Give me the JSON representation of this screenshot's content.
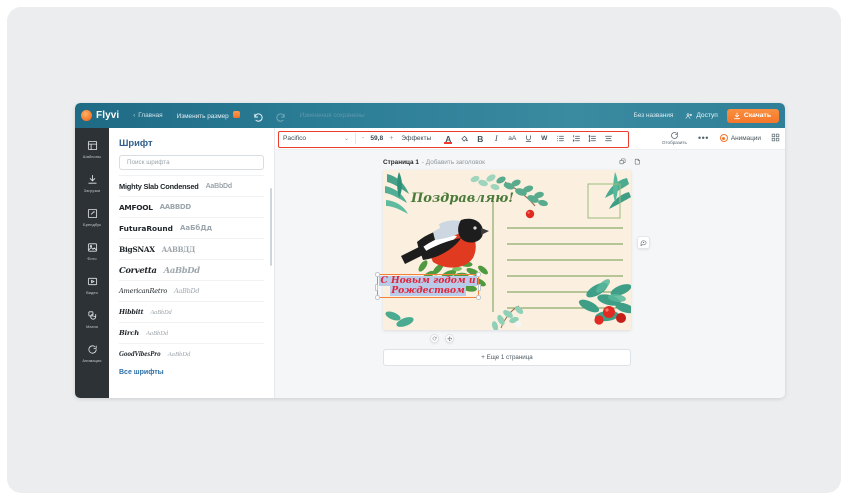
{
  "app": {
    "brand": "Flyvi",
    "home_label": "Главная",
    "resize_label": "Изменить размер",
    "saved_status": "Изменения сохранены",
    "doc_title": "Без названия",
    "access_label": "Доступ",
    "download_label": "Скачать",
    "accent_orange": "#f4762a",
    "header_teal": "#2b7d96"
  },
  "toolbar": {
    "font_name": "Pacifico",
    "minus": "-",
    "font_size": "59,8",
    "plus": "+",
    "effects_label": "Эффекты",
    "icons": [
      {
        "name": "text-color-icon",
        "glyph": "A"
      },
      {
        "name": "fill-color-icon",
        "glyph": "◕"
      },
      {
        "name": "bold-icon",
        "glyph": "B"
      },
      {
        "name": "italic-icon",
        "glyph": "I"
      },
      {
        "name": "letter-case-icon",
        "glyph": "aA"
      },
      {
        "name": "underline-icon",
        "glyph": "U"
      },
      {
        "name": "strikethrough-icon",
        "glyph": "W"
      },
      {
        "name": "bullet-list-icon",
        "glyph": "☰"
      },
      {
        "name": "numbered-list-icon",
        "glyph": "☰"
      },
      {
        "name": "line-spacing-icon",
        "glyph": "☰"
      },
      {
        "name": "align-icon",
        "glyph": "☰"
      }
    ],
    "display_label": "Отобразить",
    "more_label": "•••",
    "animations_label": "Анимации",
    "grid_icon": "grid-icon",
    "highlight_color": "#ee3b2f"
  },
  "rail": {
    "items": [
      {
        "label": "Шаблоны",
        "icon": "templates-icon"
      },
      {
        "label": "Загрузки",
        "icon": "upload-icon"
      },
      {
        "label": "Брендбук",
        "icon": "brandbook-icon"
      },
      {
        "label": "Фото",
        "icon": "photo-icon"
      },
      {
        "label": "Видео",
        "icon": "video-icon"
      },
      {
        "label": "Магия",
        "icon": "magic-icon"
      },
      {
        "label": "Анимации",
        "icon": "animation-icon"
      }
    ]
  },
  "font_panel": {
    "title": "Шрифт",
    "search_placeholder": "Поиск шрифта",
    "all_fonts_label": "Все шрифты",
    "fonts": [
      {
        "name": "Mighty Slab Condensed",
        "sample": "AaBbDd"
      },
      {
        "name": "AMFOOL",
        "sample": "AABBDD"
      },
      {
        "name": "FuturaRound",
        "sample": "АаБбДд"
      },
      {
        "name": "BigSNAX",
        "sample": "AABBДД"
      },
      {
        "name": "Corvetta",
        "sample": "AaBbDd"
      },
      {
        "name": "AmericanRetro",
        "sample": "AaBbDd"
      },
      {
        "name": "Hibbitt",
        "sample": "AaBbDd"
      },
      {
        "name": "Birch",
        "sample": "AaBbDd"
      },
      {
        "name": "GoodVibesPro",
        "sample": "AaBbDd"
      }
    ]
  },
  "canvas": {
    "page_label": "Страница 1",
    "page_title_placeholder": "- Добавить заголовок",
    "duplicate_icon": "duplicate-icon",
    "copy_icon": "copy-page-icon",
    "add_page_label": "+ Еще 1 страница",
    "rotate_icon": "rotate-icon",
    "move_icon": "move-icon",
    "comment_icon": "comment-icon",
    "postcard": {
      "greeting_text": "Поздравляю!",
      "selected_text_line1": "С Новым годом и",
      "selected_text_line2": "Рождеством",
      "background_color": "#fbf0df",
      "line_color": "#6f9a52",
      "greeting_color": "#4a7a3a",
      "selected_text_color": "#e0243c",
      "bird_body_color": "#e03a20",
      "berry_color": "#e02a22"
    }
  }
}
